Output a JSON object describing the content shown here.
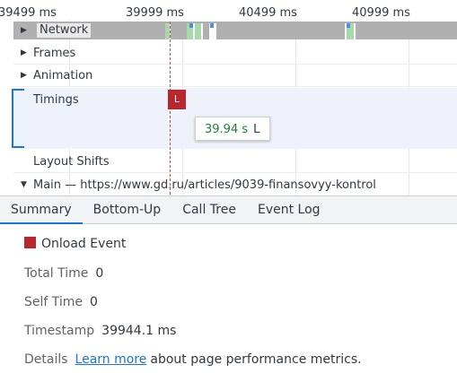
{
  "ruler": {
    "ticks": [
      "39499 ms",
      "39999 ms",
      "40499 ms",
      "40999 ms"
    ]
  },
  "tracks": {
    "network": "Network",
    "frames": "Frames",
    "animation": "Animation",
    "timings": "Timings",
    "layout_shifts": "Layout Shifts",
    "main": "Main — https://www.gd.ru/articles/9039-finansovyy-kontrol"
  },
  "marker": {
    "letter": "L",
    "color": "#b7272d"
  },
  "tooltip": {
    "time": "39.94 s",
    "name": "L"
  },
  "tabs": [
    "Summary",
    "Bottom-Up",
    "Call Tree",
    "Event Log"
  ],
  "active_tab": "Summary",
  "summary": {
    "event_title": "Onload Event",
    "total_time_label": "Total Time",
    "total_time_value": "0",
    "self_time_label": "Self Time",
    "self_time_value": "0",
    "timestamp_label": "Timestamp",
    "timestamp_value": "39944.1 ms",
    "details_label": "Details",
    "details_link": "Learn more",
    "details_text": "about page performance metrics."
  },
  "colors": {
    "accent": "#1a73e8",
    "marker": "#b7272d",
    "tooltip_value": "#1e7e34"
  },
  "icons": {
    "expand": "triangle-right-icon",
    "collapse": "triangle-down-icon"
  }
}
